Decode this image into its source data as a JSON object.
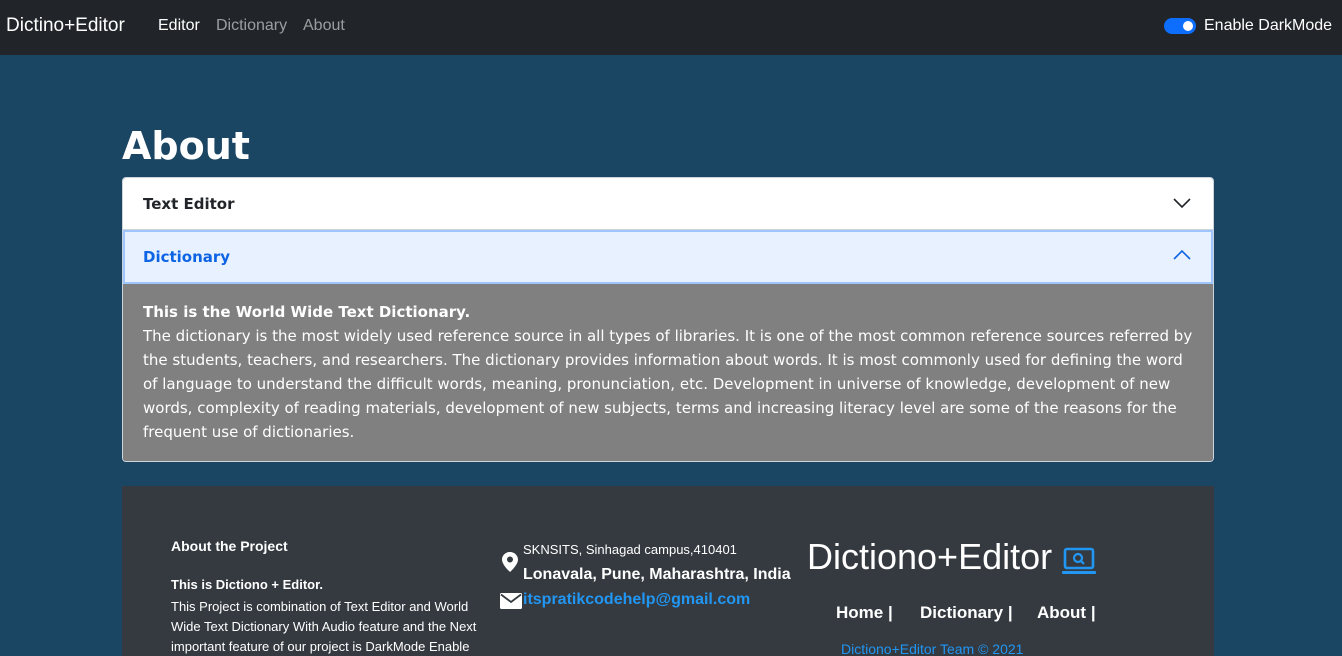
{
  "navbar": {
    "brand": "Dictino+Editor",
    "links": [
      "Editor",
      "Dictionary",
      "About"
    ],
    "darkmode_label": "Enable DarkMode",
    "darkmode_enabled": true
  },
  "page": {
    "title": "About"
  },
  "accordion": {
    "items": [
      {
        "title": "Text Editor",
        "expanded": false
      },
      {
        "title": "Dictionary",
        "expanded": true,
        "body_lead": "This is the World Wide Text Dictionary.",
        "body_text": "The dictionary is the most widely used reference source in all types of libraries. It is one of the most common reference sources referred by the students, teachers, and researchers. The dictionary provides information about words. It is most commonly used for defining the word of language to understand the difficult words, meaning, pronunciation, etc. Development in universe of knowledge, development of new words, complexity of reading materials, development of new subjects, terms and increasing literacy level are some of the reasons for the frequent use of dictionaries."
      }
    ]
  },
  "footer": {
    "about_title": "About the Project",
    "about_lead": "This is Dictiono + Editor.",
    "about_text": "This Project is combination of Text Editor and World Wide Text Dictionary With Audio feature and the Next important feature of our project is DarkMode Enable",
    "address_line1": "SKNSITS, Sinhagad campus,410401",
    "address_line2": "Lonavala, Pune, Maharashtra, India",
    "email": "itspratikcodehelp@gmail.com",
    "brand": "Dictiono+Editor",
    "links": [
      "Home |",
      "Dictionary |",
      "About |"
    ],
    "copyright": "Dictiono+Editor Team © 2021"
  },
  "colors": {
    "page_bg": "#1a4563",
    "navbar_bg": "#212529",
    "accent": "#0d6efd",
    "footer_bg": "#343a40",
    "link_blue": "#2196f3"
  }
}
